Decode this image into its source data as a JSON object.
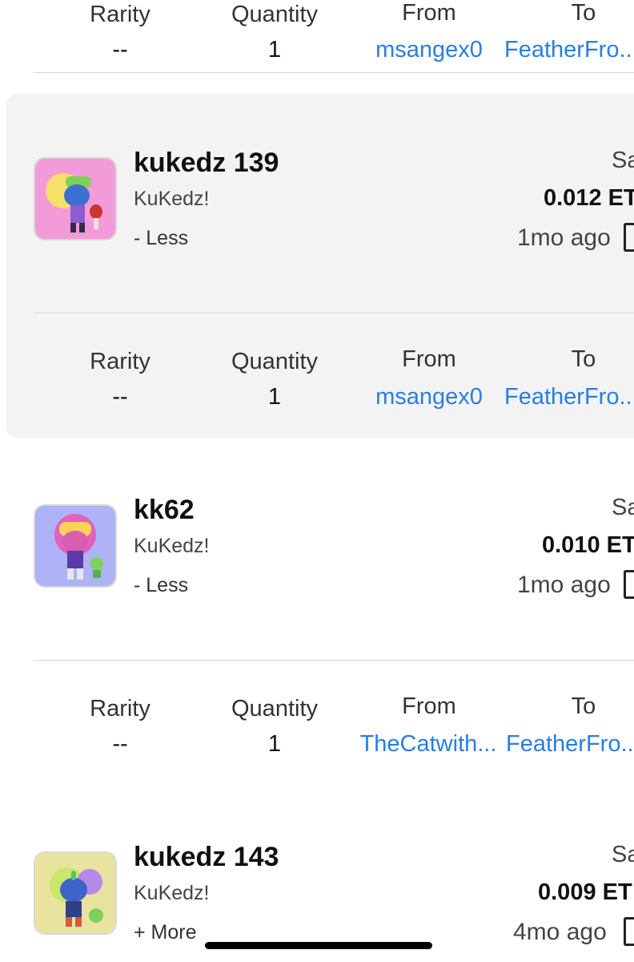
{
  "headers": {
    "rarity": "Rarity",
    "quantity": "Quantity",
    "from": "From",
    "to": "To"
  },
  "top_row": {
    "rarity": "--",
    "quantity": "1",
    "from": "msangex0",
    "to": "FeatherFro..."
  },
  "items": [
    {
      "title": "kukedz 139",
      "collection": "KuKedz!",
      "toggle": "- Less",
      "sale": "Sa",
      "price": "0.012 ET",
      "time": "1mo ago",
      "details": {
        "rarity": "--",
        "quantity": "1",
        "from": "msangex0",
        "to": "FeatherFro..."
      },
      "thumb_bg": "#f39bd8",
      "char_color": "#3d6fd1"
    },
    {
      "title": "kk62",
      "collection": "KuKedz!",
      "toggle": "- Less",
      "sale": "Sa",
      "price": "0.010 ET",
      "time": "1mo ago",
      "details": {
        "rarity": "--",
        "quantity": "1",
        "from": "TheCatwith...",
        "to": "FeatherFro..."
      },
      "thumb_bg": "#aeb2f6",
      "char_color": "#d95fae"
    },
    {
      "title": "kukedz 143",
      "collection": "KuKedz!",
      "toggle": "+ More",
      "sale": "Sa",
      "price": "0.009 ET",
      "time": "4mo ago",
      "thumb_bg": "#e9e3a0",
      "char_color": "#3e63c9"
    }
  ],
  "colors": {
    "link": "#2a7de1",
    "selected_bg": "#f3f3f3"
  }
}
